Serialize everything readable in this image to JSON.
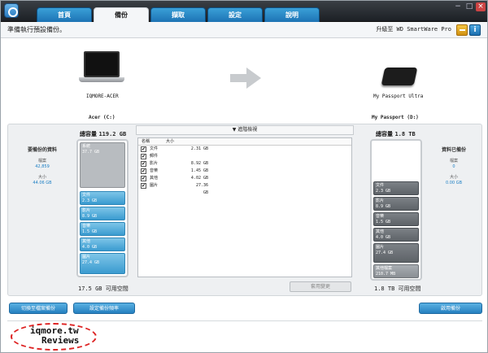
{
  "tabs": [
    "首頁",
    "備份",
    "擷取",
    "設定",
    "說明"
  ],
  "active_tab": "備份",
  "window_controls": {
    "minimize": "−",
    "maximize": "□",
    "close": "×"
  },
  "status": "準備執行預設備份。",
  "upgrade": "升級至 WD SmartWare Pro",
  "source": {
    "name": "IQMORE-ACER",
    "volume": "Acer (C:)",
    "capacity_label": "總容量",
    "capacity": "119.2 GB",
    "free": "17.5 GB 可用空間"
  },
  "target": {
    "name": "My Passport Ultra",
    "volume": "My Passport (D:)",
    "capacity_label": "總容量",
    "capacity": "1.8 TB",
    "free": "1.8 TB 可用空間"
  },
  "left_card": {
    "title": "要備份的資料",
    "files_label": "檔案",
    "files": "42,859",
    "size_label": "大小",
    "size": "44.06 GB"
  },
  "right_card": {
    "title": "資料已備份",
    "files_label": "檔案",
    "files": "0",
    "size_label": "大小",
    "size": "0.00 GB"
  },
  "source_bar": [
    {
      "label": "系統",
      "value": "37.7 GB"
    },
    {
      "label": "文件",
      "value": "2.3 GB"
    },
    {
      "label": "影片",
      "value": "8.9 GB"
    },
    {
      "label": "音樂",
      "value": "1.5 GB"
    },
    {
      "label": "其他",
      "value": "4.0 GB"
    },
    {
      "label": "圖片",
      "value": "27.4 GB"
    }
  ],
  "target_bar": [
    {
      "label": "文件",
      "value": "2.3 GB"
    },
    {
      "label": "影片",
      "value": "8.9 GB"
    },
    {
      "label": "音樂",
      "value": "1.5 GB"
    },
    {
      "label": "其他",
      "value": "4.0 GB"
    },
    {
      "label": "圖片",
      "value": "27.4 GB"
    },
    {
      "label": "其他檔案",
      "value": "210.7 MB"
    }
  ],
  "advanced_view": "▼ 進階檢視",
  "filelist": {
    "headers": [
      "名稱",
      "大小"
    ],
    "rows": [
      {
        "name": "文件",
        "size": "2.31 GB"
      },
      {
        "name": "郵件",
        "size": ""
      },
      {
        "name": "影片",
        "size": "8.92 GB"
      },
      {
        "name": "音樂",
        "size": "1.45 GB"
      },
      {
        "name": "其他",
        "size": "4.02 GB"
      },
      {
        "name": "圖片",
        "size": "27.36 GB"
      }
    ]
  },
  "apply_button": "套用變更",
  "buttons": {
    "switch_mode": "切換至檔案備份",
    "set_frequency": "設定備份頻率",
    "start_backup": "啟用備份"
  },
  "watermark": {
    "line1": "iqmore.tw",
    "line2": "Reviews"
  }
}
